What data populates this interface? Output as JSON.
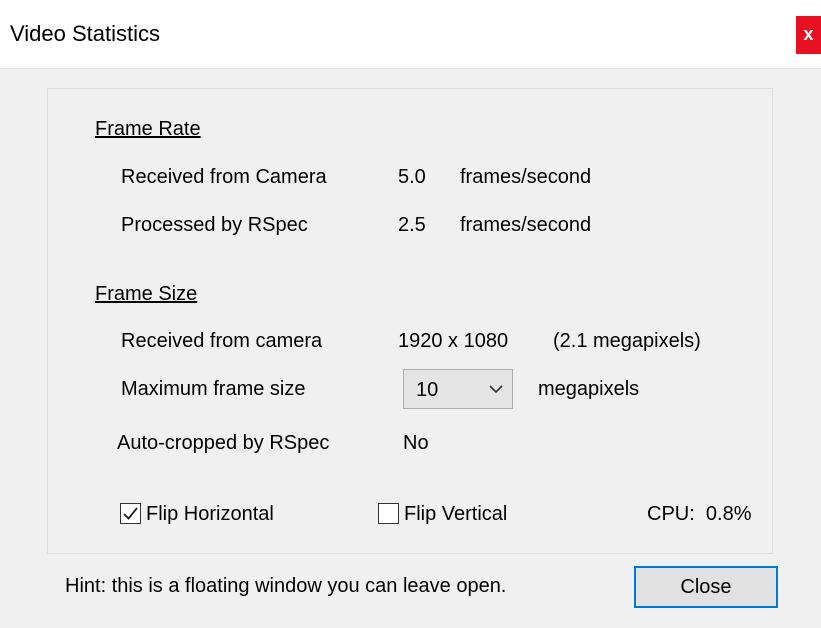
{
  "window": {
    "title": "Video Statistics",
    "close_glyph": "x"
  },
  "frame_rate": {
    "heading": "Frame Rate",
    "received_label": "Received from Camera",
    "received_value": "5.0",
    "received_unit": "frames/second",
    "processed_label": "Processed by RSpec",
    "processed_value": "2.5",
    "processed_unit": "frames/second"
  },
  "frame_size": {
    "heading": "Frame Size",
    "received_label": "Received from camera",
    "received_value": "1920 x 1080",
    "received_note": "(2.1 megapixels)",
    "max_label": "Maximum frame size",
    "max_value": "10",
    "max_unit": "megapixels",
    "autocrop_label": "Auto-cropped by RSpec",
    "autocrop_value": "No"
  },
  "options": {
    "flip_h_label": "Flip Horizontal",
    "flip_h_checked": true,
    "flip_v_label": "Flip Vertical",
    "flip_v_checked": false,
    "cpu_text": "CPU:  0.8%"
  },
  "footer": {
    "hint": "Hint: this is a floating window you can leave open.",
    "close_label": "Close"
  },
  "colors": {
    "accent": "#0078d7",
    "close_bg": "#e81123",
    "panel_bg": "#f0f0f0"
  },
  "icons": {
    "dropdown": "chevron-down-icon",
    "check": "checkmark-icon",
    "close": "close-icon"
  }
}
